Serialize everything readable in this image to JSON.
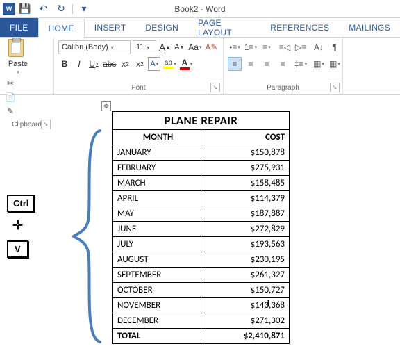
{
  "app": {
    "title": "Book2 - Word",
    "word_icon": "W"
  },
  "qat": {
    "save": "💾",
    "undo": "↶",
    "redo": "↻",
    "more": "▾"
  },
  "tabs": {
    "file": "FILE",
    "home": "HOME",
    "insert": "INSERT",
    "design": "DESIGN",
    "pagelayout": "PAGE LAYOUT",
    "references": "REFERENCES",
    "mailings": "MAILINGS"
  },
  "ribbon": {
    "clipboard": {
      "label": "Clipboard",
      "paste": "Paste",
      "cut": "✂",
      "copy": "📄",
      "fmt": "✎"
    },
    "font": {
      "label": "Font",
      "name": "Calibri (Body)",
      "size": "11",
      "growA": "A",
      "shrinkA": "A",
      "caseAa": "Aa",
      "clear": "✎",
      "bold": "B",
      "italic": "I",
      "underline": "U",
      "strike": "abc",
      "sub": "x",
      "sup": "x",
      "effects": "A",
      "hilite": "ab",
      "color": "A"
    },
    "paragraph": {
      "label": "Paragraph",
      "bullets": "≡",
      "numbering": "≡",
      "multilist": "≡",
      "outdent": "◁",
      "indent": "▷",
      "sort": "A↓",
      "marks": "¶",
      "alignL": "≡",
      "alignC": "≡",
      "alignR": "≡",
      "alignJ": "≡",
      "spacing": "≡",
      "shading": "▦",
      "borders": "▦"
    }
  },
  "keys": {
    "ctrl": "Ctrl",
    "plus": "✛",
    "v": "V"
  },
  "move_handle": "✥",
  "table": {
    "title": "PLANE REPAIR",
    "col1": "MONTH",
    "col2": "COST",
    "rows": [
      {
        "m": "JANUARY",
        "c": "$150,878"
      },
      {
        "m": "FEBRUARY",
        "c": "$275,931"
      },
      {
        "m": "MARCH",
        "c": "$158,485"
      },
      {
        "m": "APRIL",
        "c": "$114,379"
      },
      {
        "m": "MAY",
        "c": "$187,887"
      },
      {
        "m": "JUNE",
        "c": "$272,829"
      },
      {
        "m": "JULY",
        "c": "$193,563"
      },
      {
        "m": "AUGUST",
        "c": "$230,195"
      },
      {
        "m": "SEPTEMBER",
        "c": "$261,327"
      },
      {
        "m": "OCTOBER",
        "c": "$150,727"
      },
      {
        "m": "NOVEMBER",
        "c": "$143,368"
      },
      {
        "m": "DECEMBER",
        "c": "$271,302"
      }
    ],
    "total_label": "TOTAL",
    "total_value": "$2,410,871"
  }
}
